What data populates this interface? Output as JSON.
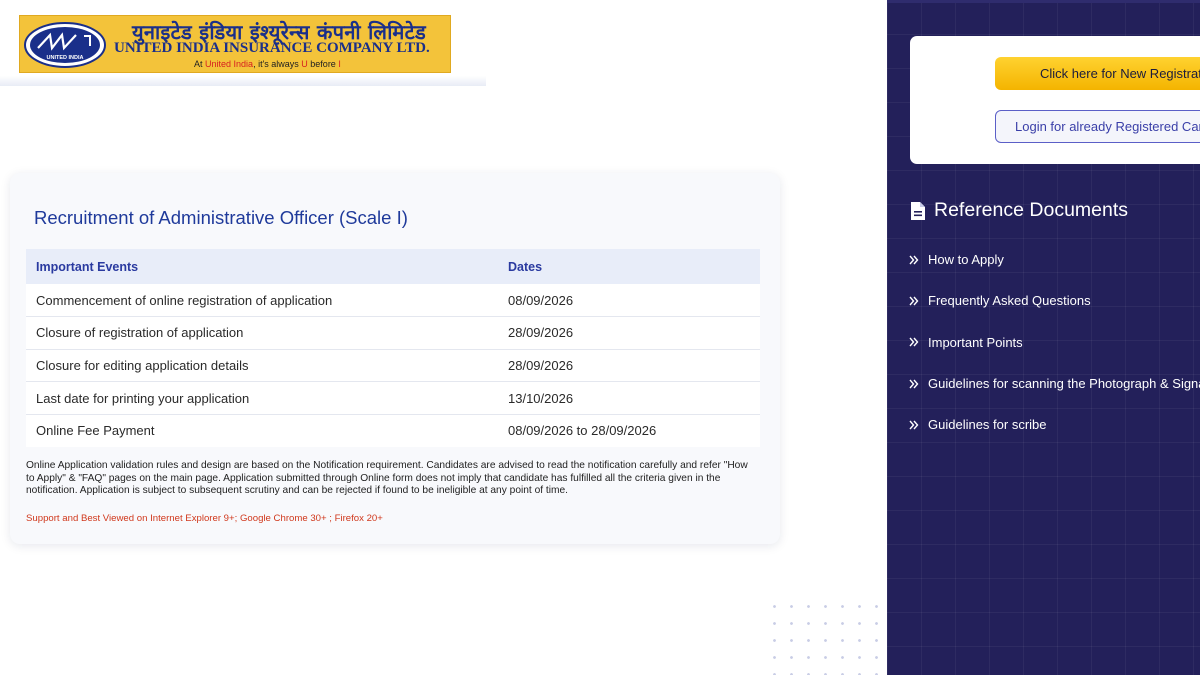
{
  "header": {
    "logo_hindi": "युनाइटेड इंडिया इंश्यूरेन्स कंपनी लिमिटेड",
    "logo_english": "UNITED INDIA INSURANCE COMPANY LTD.",
    "tagline_prefix": "At ",
    "tagline_brand": "United India",
    "tagline_mid": ", it's always ",
    "tagline_u": "U",
    "tagline_before": " before ",
    "tagline_i": "I",
    "emblem_text": "UNITED INDIA"
  },
  "main": {
    "title": "Recruitment of Administrative Officer (Scale I)",
    "table": {
      "headers": [
        "Important Events",
        "Dates"
      ],
      "rows": [
        {
          "event": "Commencement of online registration of application",
          "date": "08/09/2026"
        },
        {
          "event": "Closure of registration of application",
          "date": "28/09/2026"
        },
        {
          "event": "Closure for editing application details",
          "date": "28/09/2026"
        },
        {
          "event": "Last date for printing your application",
          "date": "13/10/2026"
        },
        {
          "event": "Online Fee Payment",
          "date": "08/09/2026 to 28/09/2026"
        }
      ]
    },
    "notice": "Online Application validation rules and design are based on the Notification requirement. Candidates are advised to read the notification carefully and refer \"How to Apply\" & \"FAQ\" pages on the main page. Application submitted through Online form does not imply that candidate has fulfilled all the criteria given in the notification. Application is subject to subsequent scrutiny and can be rejected if found to be ineligible at any point of time.",
    "browser_note": "Support and Best Viewed on Internet Explorer 9+; Google Chrome 30+ ; Firefox 20+"
  },
  "sidebar": {
    "new_registration_label": "Click here for New Registration",
    "login_label": "Login for already Registered Candidates",
    "reference_heading": "Reference Documents",
    "items": [
      {
        "label": "How to Apply"
      },
      {
        "label": "Frequently Asked Questions"
      },
      {
        "label": "Important Points"
      },
      {
        "label": "Guidelines for scanning the Photograph & Signature"
      },
      {
        "label": "Guidelines for scribe"
      }
    ]
  },
  "colors": {
    "brand_blue": "#1f3a9b",
    "sidebar_bg": "#23205a",
    "primary_button": "#f4b400",
    "alert_red": "#d0381c"
  },
  "icons": {
    "emblem": "company-emblem-icon",
    "reference_doc": "document-icon",
    "bullet": "double-chevron-right-icon"
  }
}
